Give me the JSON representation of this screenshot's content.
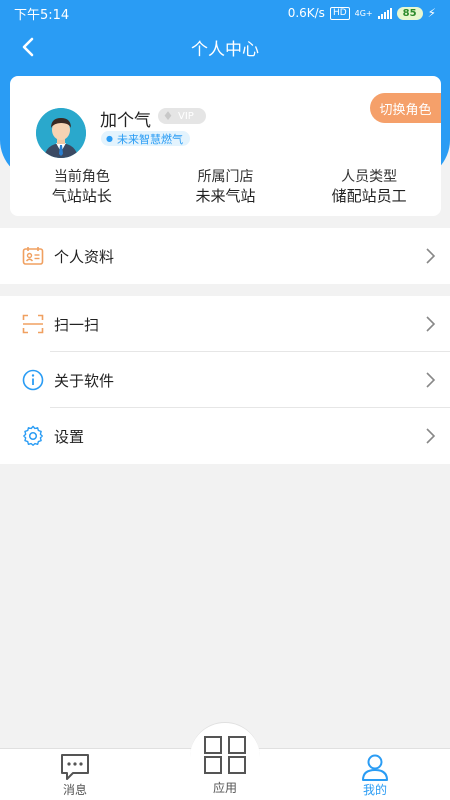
{
  "status_bar": {
    "time": "下午5:14",
    "speed": "0.6K/s",
    "hd": "HD",
    "network": "4G+",
    "battery": "85"
  },
  "nav": {
    "title": "个人中心"
  },
  "profile": {
    "name": "加个气",
    "vip": "VIP",
    "company": "未来智慧燃气",
    "switch_role": "切换角色",
    "info": [
      {
        "label": "当前角色",
        "value": "气站站长"
      },
      {
        "label": "所属门店",
        "value": "未来气站"
      },
      {
        "label": "人员类型",
        "value": "储配站员工"
      }
    ]
  },
  "menu": {
    "profile": "个人资料",
    "scan": "扫一扫",
    "about": "关于软件",
    "settings": "设置"
  },
  "tabs": {
    "messages": "消息",
    "apps": "应用",
    "mine": "我的"
  },
  "colors": {
    "primary": "#2a9cf4",
    "accent": "#f5a06a",
    "background": "#f2f2f2"
  },
  "icons": {
    "back": "chevron-left-icon",
    "profile": "id-card-icon",
    "scan": "scan-icon",
    "about": "info-icon",
    "settings": "gear-icon",
    "messages": "chat-icon",
    "apps": "grid-icon",
    "mine": "user-icon"
  }
}
